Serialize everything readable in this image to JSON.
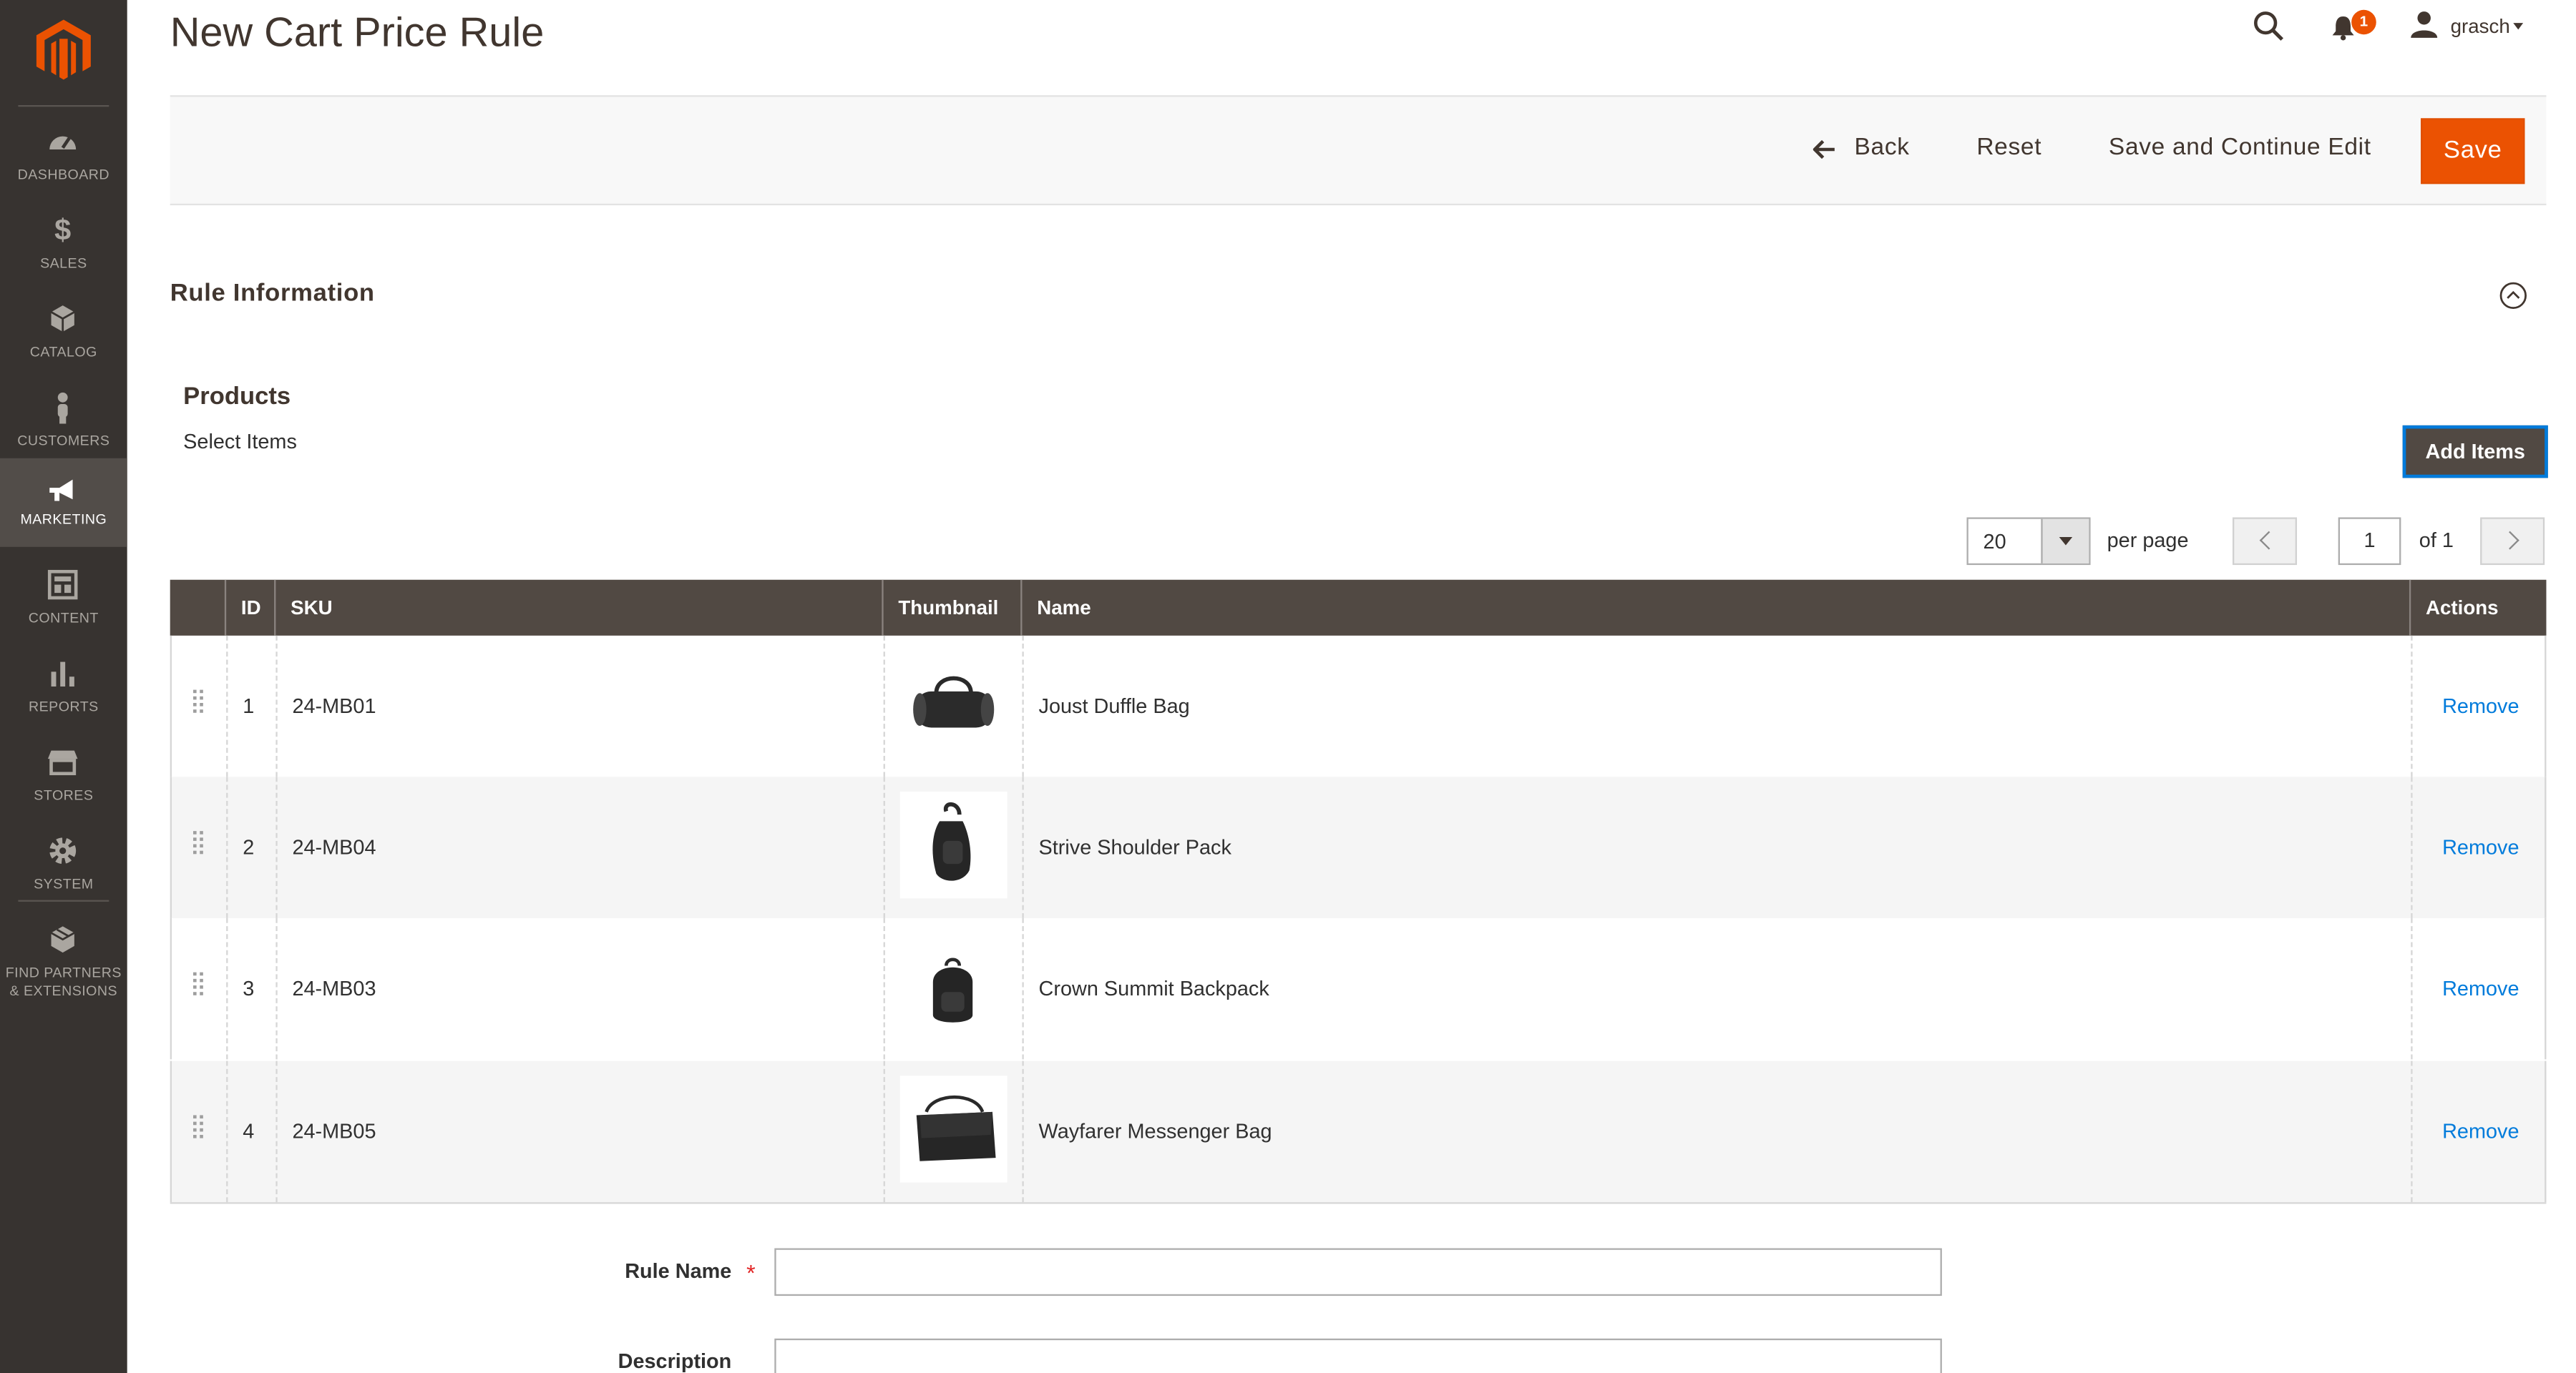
{
  "page": {
    "title": "New Cart Price Rule"
  },
  "sidebar": {
    "items": [
      {
        "label": "DASHBOARD",
        "icon": "dashboard-icon"
      },
      {
        "label": "SALES",
        "icon": "dollar-icon"
      },
      {
        "label": "CATALOG",
        "icon": "cube-icon"
      },
      {
        "label": "CUSTOMERS",
        "icon": "person-icon"
      },
      {
        "label": "MARKETING",
        "icon": "megaphone-icon",
        "active": true
      },
      {
        "label": "CONTENT",
        "icon": "layout-icon"
      },
      {
        "label": "REPORTS",
        "icon": "bar-chart-icon"
      },
      {
        "label": "STORES",
        "icon": "store-icon"
      },
      {
        "label": "SYSTEM",
        "icon": "gear-icon"
      },
      {
        "label": "FIND PARTNERS",
        "label2": "& EXTENSIONS",
        "icon": "box-icon"
      }
    ]
  },
  "header": {
    "notification_count": "1",
    "user_name": "grasch"
  },
  "toolbar": {
    "back_label": "Back",
    "reset_label": "Reset",
    "save_continue_label": "Save and Continue Edit",
    "save_label": "Save"
  },
  "section": {
    "title": "Rule Information",
    "products_title": "Products",
    "select_items": "Select Items",
    "add_items_label": "Add Items"
  },
  "pager": {
    "per_page_value": "20",
    "per_page_label": "per page",
    "current_page": "1",
    "of_label": "of 1"
  },
  "grid": {
    "columns": [
      "ID",
      "SKU",
      "Thumbnail",
      "Name",
      "Actions"
    ],
    "rows": [
      {
        "id": "1",
        "sku": "24-MB01",
        "name": "Joust Duffle Bag",
        "action": "Remove",
        "thumb": "duffle-bag-image"
      },
      {
        "id": "2",
        "sku": "24-MB04",
        "name": "Strive Shoulder Pack",
        "action": "Remove",
        "thumb": "shoulder-pack-image"
      },
      {
        "id": "3",
        "sku": "24-MB03",
        "name": "Crown Summit Backpack",
        "action": "Remove",
        "thumb": "backpack-image"
      },
      {
        "id": "4",
        "sku": "24-MB05",
        "name": "Wayfarer Messenger Bag",
        "action": "Remove",
        "thumb": "messenger-bag-image"
      }
    ]
  },
  "form": {
    "rule_name_label": "Rule Name",
    "required_mark": "*",
    "rule_name_value": "",
    "description_label": "Description"
  },
  "colors": {
    "accent": "#eb5202",
    "sidebar_bg": "#373330",
    "grid_header_bg": "#514943",
    "link": "#007bdb"
  }
}
